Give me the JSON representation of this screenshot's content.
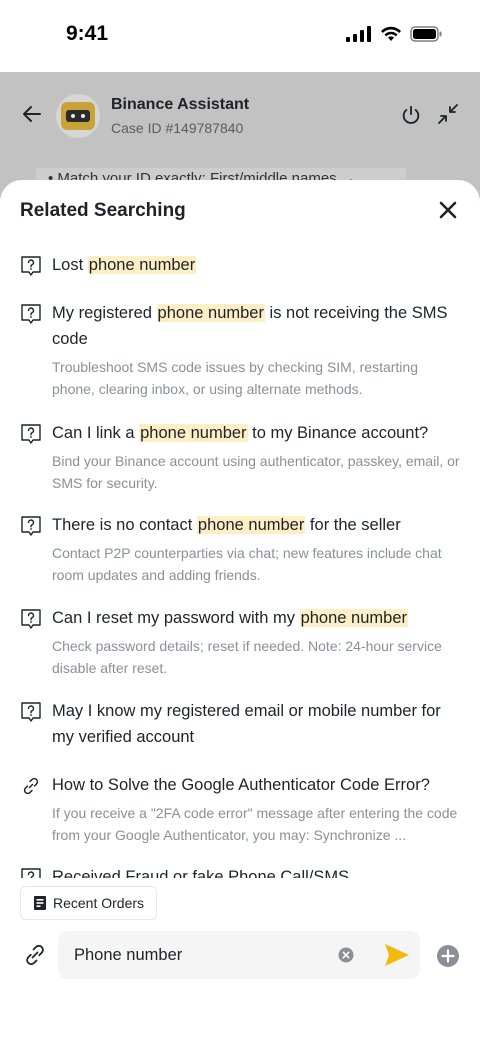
{
  "status": {
    "time": "9:41"
  },
  "header": {
    "title": "Binance Assistant",
    "case_id": "Case ID #149787840",
    "bg_message": "•  Match your ID exactly: First/middle names →"
  },
  "sheet": {
    "title": "Related Searching",
    "items": [
      {
        "icon": "question-icon",
        "pre": "Lost ",
        "hl": "phone number",
        "post": "",
        "desc": ""
      },
      {
        "icon": "question-icon",
        "pre": "My registered ",
        "hl": "phone number",
        "post": " is not receiving the SMS code",
        "desc": "Troubleshoot SMS code issues by checking SIM, restarting phone, clearing inbox, or using alternate methods."
      },
      {
        "icon": "question-icon",
        "pre": "Can I link a ",
        "hl": "phone number",
        "post": " to my Binance account?",
        "desc": "Bind your Binance account using authenticator, passkey, email, or SMS for security."
      },
      {
        "icon": "question-icon",
        "pre": "There is no contact ",
        "hl": "phone number",
        "post": " for the seller",
        "desc": "Contact P2P counterparties via chat; new features include chat room updates and adding friends."
      },
      {
        "icon": "question-icon",
        "pre": "Can I reset my password with my ",
        "hl": "phone number",
        "post": "",
        "desc": "Check password details; reset if needed. Note: 24-hour service disable after reset."
      },
      {
        "icon": "question-icon",
        "pre": "May I know my registered email or mobile number for my verified account",
        "hl": "",
        "post": "",
        "desc": ""
      },
      {
        "icon": "link-icon",
        "pre": "How to Solve the Google Authenticator Code Error?",
        "hl": "",
        "post": "",
        "desc": "If you receive a \"2FA code error\" message after entering the code from your Google Authenticator, you may: Synchronize ..."
      },
      {
        "icon": "question-icon",
        "pre": "Received Fraud or fake Phone Call/SMS",
        "hl": "",
        "post": "",
        "desc": ""
      }
    ]
  },
  "chip": {
    "label": "Recent Orders"
  },
  "composer": {
    "value": "Phone number"
  },
  "colors": {
    "accent": "#f0b90b",
    "highlight": "#fcefc6",
    "overlay": "#c2c2c2"
  }
}
